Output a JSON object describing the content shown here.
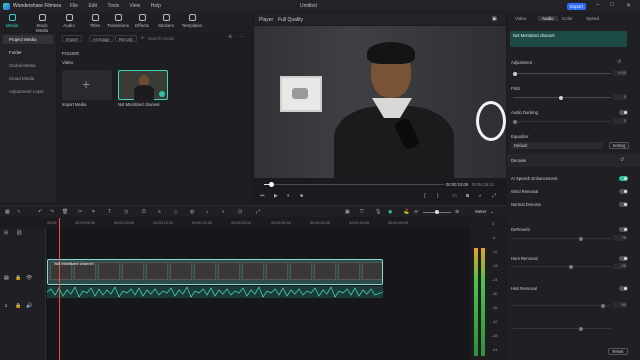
{
  "app": {
    "name": "Wondershare Filmora",
    "window_title": "Untitled",
    "export_label": "Export"
  },
  "menu": [
    "File",
    "Edit",
    "Tools",
    "View",
    "Help"
  ],
  "toolbar": {
    "items": [
      {
        "label": "Media",
        "icon": "media-icon",
        "active": true
      },
      {
        "label": "Stock Media",
        "icon": "stock-media-icon",
        "active": false
      },
      {
        "label": "Audio",
        "icon": "music-note-icon",
        "active": false
      },
      {
        "label": "Titles",
        "icon": "titles-icon",
        "active": false
      },
      {
        "label": "Transitions",
        "icon": "transitions-icon",
        "active": false
      },
      {
        "label": "Effects",
        "icon": "effects-icon",
        "active": false
      },
      {
        "label": "Stickers",
        "icon": "stickers-icon",
        "active": false
      },
      {
        "label": "Templates",
        "icon": "templates-icon",
        "active": false
      }
    ]
  },
  "sidebar": {
    "items": [
      {
        "label": "Project Media",
        "active": true
      },
      {
        "label": "Folder",
        "active": false
      },
      {
        "label": "Global Media",
        "active": false
      },
      {
        "label": "Cloud Media",
        "active": false
      },
      {
        "label": "Adjustment Layer",
        "active": false
      }
    ]
  },
  "media": {
    "import_label": "Import",
    "ai_image_label": "AI Image",
    "record_label": "Record",
    "search_placeholder": "Search media",
    "folder_heading": "FOLDER",
    "video_heading": "Video",
    "cards": [
      {
        "label": "Import Media"
      },
      {
        "label": "Not Monitized channel"
      }
    ]
  },
  "viewer": {
    "player_label": "Player",
    "quality": "Full Quality",
    "current_time": "00:00:10:09",
    "total_time": "00:04:18:14",
    "progress_fraction": 0.04
  },
  "right_panel": {
    "tabs": [
      "Video",
      "Audio",
      "Color",
      "Speed"
    ],
    "active_tab": "Audio",
    "clip_name": "Not Monitized channel",
    "sections": {
      "adjustment": "Adjustment",
      "pitch": "Pitch",
      "audio_ducking": "Audio Ducking",
      "equalizer": "Equalizer",
      "equalizer_value": "Default",
      "setting_label": "Setting",
      "denoise": "Denoise",
      "ai_speech": "AI Speech Enhancement",
      "wind_removal": "Wind Removal",
      "normal_denoise": "Normal Denoise",
      "dereverb": "DeReverb",
      "hum_removal": "Hum Removal",
      "hiss_removal": "Hiss Removal",
      "reset_label": "Reset"
    },
    "adjustment_value": "0.00",
    "pitch_value": "0",
    "ducking_value": "0",
    "dereverb_value": "70",
    "hum_value": "-25",
    "hiss_value": "50"
  },
  "timeline": {
    "ruler_ticks": [
      "00:00",
      "00:00:05:00",
      "00:00:10:00",
      "00:00:15:00",
      "00:00:20:00",
      "00:00:25:00",
      "00:00:30:00",
      "00:00:35:00",
      "00:00:40:00",
      "00:00:45:00"
    ],
    "clip_label": "Not Monitized channel",
    "meter_label": "Meter",
    "meter_scale": [
      "0",
      "-6",
      "-12",
      "-18",
      "-24",
      "-30",
      "-36",
      "-42",
      "-48",
      "-54"
    ]
  }
}
